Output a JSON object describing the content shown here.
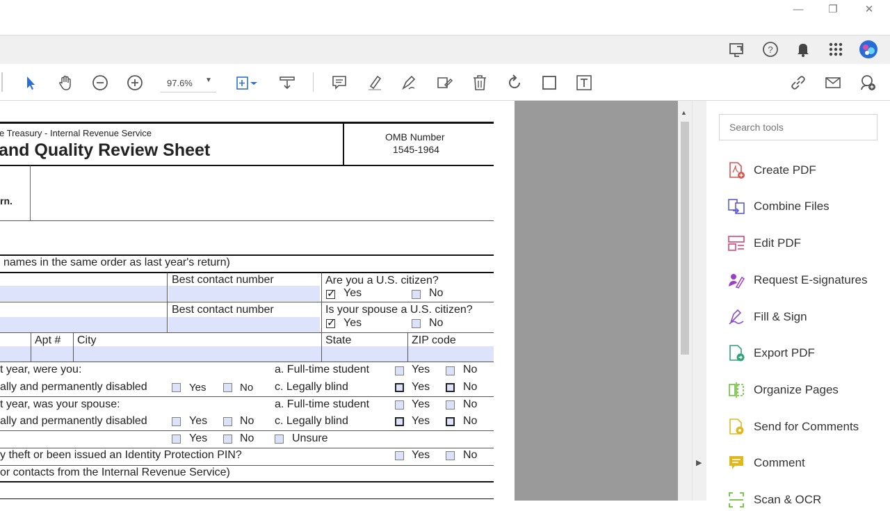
{
  "window": {
    "minimize": "—",
    "restore": "❐",
    "close": "✕"
  },
  "toolbar": {
    "zoom": "97.6%"
  },
  "form": {
    "agency": "e Treasury - Internal Revenue Service",
    "title": "and Quality Review Sheet",
    "omb_label": "OMB Number",
    "omb_number": "1545-1964",
    "row1_label": "rn.",
    "names_note": "names in the same order as last year's return)",
    "best_contact_1": "Best contact number",
    "best_contact_2": "Best contact number",
    "citizen_q": "Are you a U.S. citizen?",
    "spouse_citizen_q": "Is your spouse a U.S. citizen?",
    "yes": "Yes",
    "no": "No",
    "unsure": "Unsure",
    "apt": "Apt #",
    "city": "City",
    "state": "State",
    "zip": "ZIP code",
    "were_you": "t year, were you:",
    "was_spouse": "t year, was your spouse:",
    "disabled": "ally and permanently disabled",
    "full_time": "a. Full-time student",
    "legally_blind": "c. Legally blind",
    "identity_q": "y theft or been issued an Identity Protection PIN?",
    "contacts_note": "or contacts from the Internal Revenue Service)"
  },
  "search": {
    "placeholder": "Search tools"
  },
  "tools": [
    {
      "label": "Create PDF",
      "icon": "create-pdf-icon",
      "color": "#d9534f"
    },
    {
      "label": "Combine Files",
      "icon": "combine-files-icon",
      "color": "#5b5bd6"
    },
    {
      "label": "Edit PDF",
      "icon": "edit-pdf-icon",
      "color": "#d6457a"
    },
    {
      "label": "Request E-signatures",
      "icon": "request-esign-icon",
      "color": "#9b3fc4"
    },
    {
      "label": "Fill & Sign",
      "icon": "fill-sign-icon",
      "color": "#8a4fc8"
    },
    {
      "label": "Export PDF",
      "icon": "export-pdf-icon",
      "color": "#2ea37a"
    },
    {
      "label": "Organize Pages",
      "icon": "organize-pages-icon",
      "color": "#6cbf3a"
    },
    {
      "label": "Send for Comments",
      "icon": "send-comments-icon",
      "color": "#e0b81e"
    },
    {
      "label": "Comment",
      "icon": "comment-icon",
      "color": "#e0b81e"
    },
    {
      "label": "Scan & OCR",
      "icon": "scan-ocr-icon",
      "color": "#6cbf3a"
    }
  ]
}
